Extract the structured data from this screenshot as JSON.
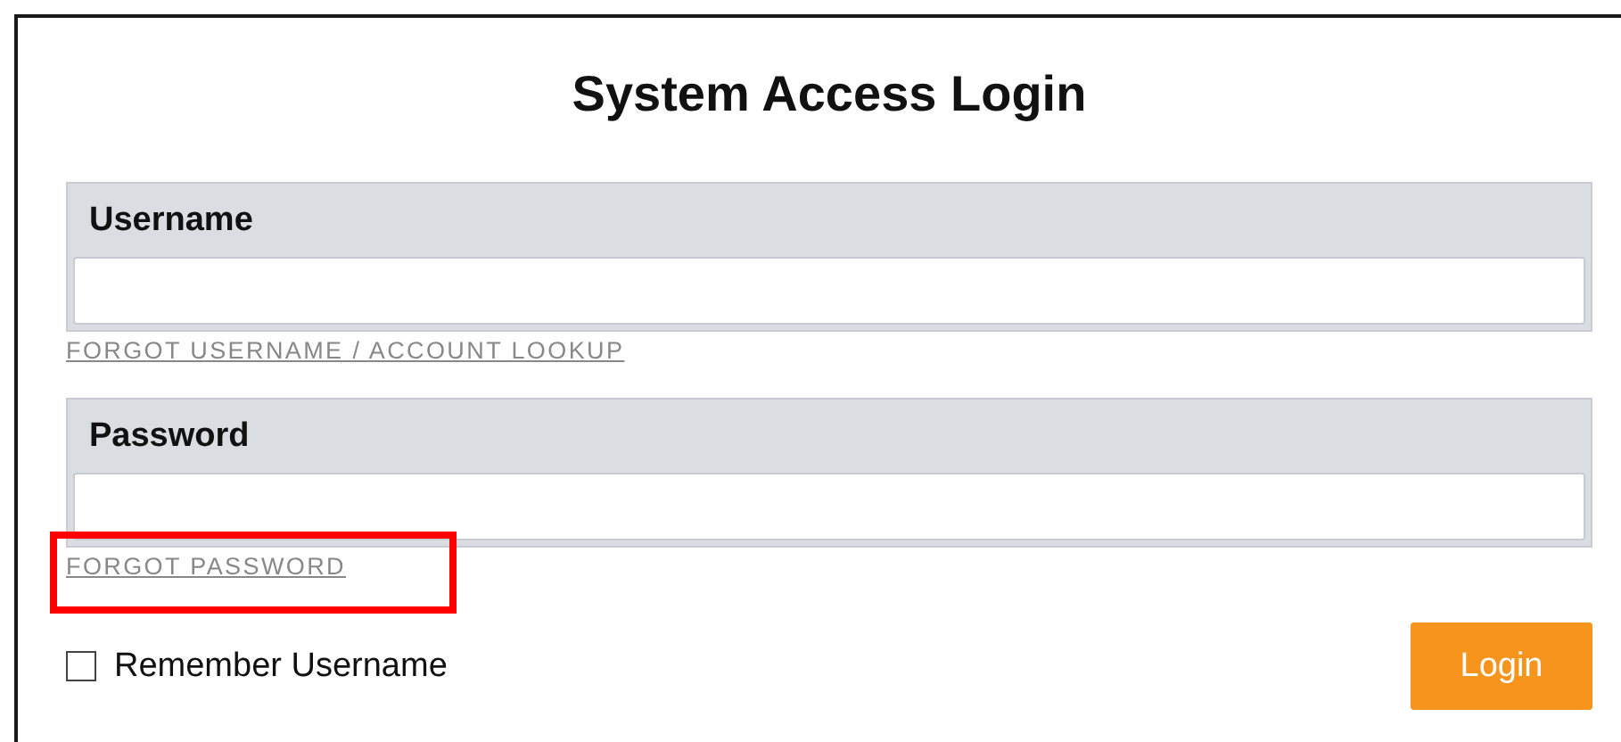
{
  "title": "System Access Login",
  "fields": [
    {
      "label": "Username",
      "link": {
        "text": "FORGOT USERNAME / ACCOUNT LOOKUP",
        "highlighted": false
      }
    },
    {
      "label": "Password",
      "link": {
        "text": "FORGOT PASSWORD",
        "highlighted": true
      }
    }
  ],
  "remember": {
    "label": "Remember Username",
    "checked": false
  },
  "login_button": "Login"
}
